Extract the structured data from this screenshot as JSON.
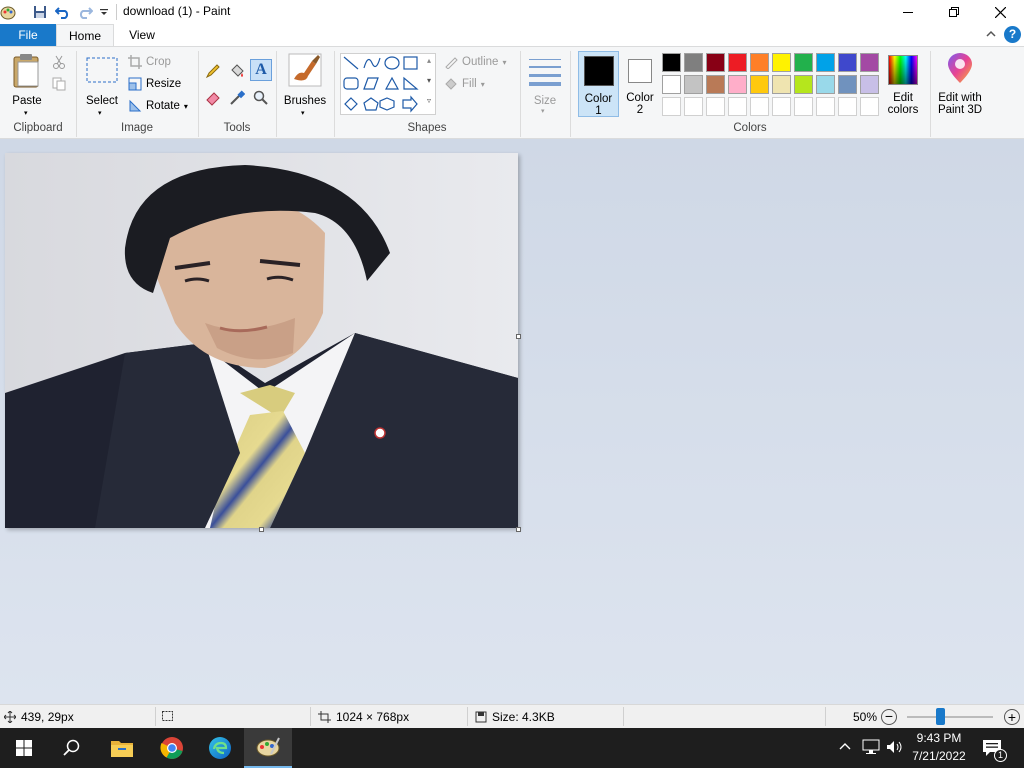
{
  "window": {
    "title": "download (1) - Paint"
  },
  "tabs": [
    {
      "label": "File"
    },
    {
      "label": "Home"
    },
    {
      "label": "View"
    }
  ],
  "ribbon": {
    "clipboard": {
      "paste_label": "Paste",
      "group_label": "Clipboard"
    },
    "image": {
      "select_label": "Select",
      "crop_label": "Crop",
      "resize_label": "Resize",
      "rotate_label": "Rotate",
      "group_label": "Image"
    },
    "tools": {
      "group_label": "Tools"
    },
    "brushes": {
      "label": "Brushes"
    },
    "shapes": {
      "outline_label": "Outline",
      "fill_label": "Fill",
      "group_label": "Shapes"
    },
    "size": {
      "label": "Size"
    },
    "colors": {
      "color1_label_line1": "Color",
      "color1_label_line2": "1",
      "color2_label_line1": "Color",
      "color2_label_line2": "2",
      "edit_colors_line1": "Edit",
      "edit_colors_line2": "colors",
      "paint3d_line1": "Edit with",
      "paint3d_line2": "Paint 3D",
      "group_label": "Colors",
      "color1_value": "#000000",
      "color2_value": "#ffffff",
      "palette_row1": [
        "#000000",
        "#7f7f7f",
        "#880015",
        "#ed1c24",
        "#ff7f27",
        "#fff200",
        "#22b14c",
        "#00a2e8",
        "#3f48cc",
        "#a349a4"
      ],
      "palette_row2": [
        "#ffffff",
        "#c3c3c3",
        "#b97a57",
        "#ffaec9",
        "#ffc90e",
        "#efe4b0",
        "#b5e61d",
        "#99d9ea",
        "#7092be",
        "#c8bfe7"
      ]
    }
  },
  "statusbar": {
    "cursor_pos": "439, 29px",
    "image_size": "1024 × 768px",
    "file_size": "Size: 4.3KB",
    "zoom": "50%",
    "zoom_fraction": 0.38
  },
  "taskbar": {
    "time": "9:43 PM",
    "date": "7/21/2022",
    "notification_count": "1"
  }
}
